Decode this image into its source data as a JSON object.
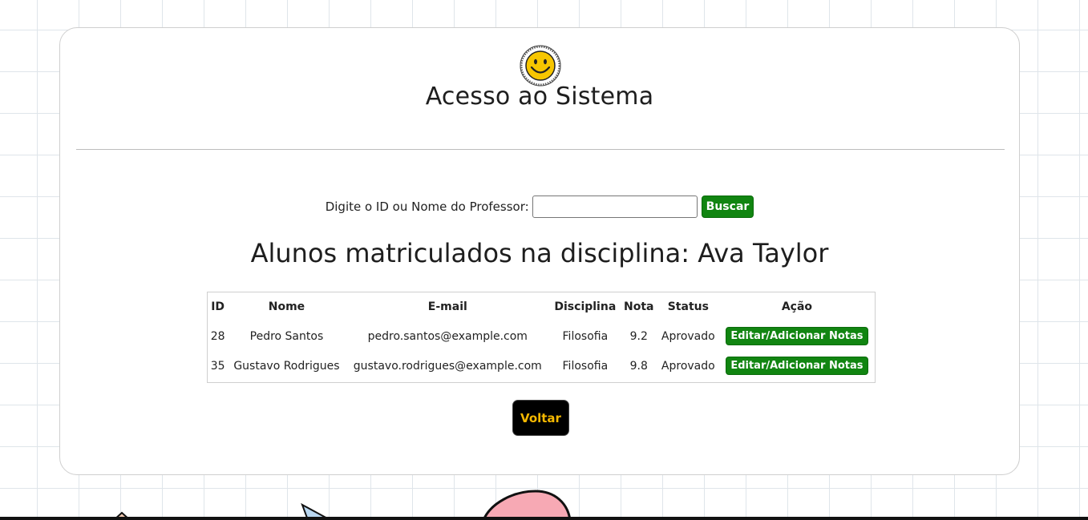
{
  "header": {
    "title": "Acesso ao Sistema"
  },
  "search": {
    "label": "Digite o ID ou Nome do Professor:",
    "value": "",
    "placeholder": "",
    "button_label": "Buscar"
  },
  "main": {
    "subtitle": "Alunos matriculados na disciplina: Ava Taylor"
  },
  "table": {
    "headers": [
      "ID",
      "Nome",
      "E-mail",
      "Disciplina",
      "Nota",
      "Status",
      "Ação"
    ],
    "rows": [
      {
        "id": "28",
        "nome": "Pedro Santos",
        "email": "pedro.santos@example.com",
        "disciplina": "Filosofia",
        "nota": "9.2",
        "status": "Aprovado",
        "acao": "Editar/Adicionar Notas"
      },
      {
        "id": "35",
        "nome": "Gustavo Rodrigues",
        "email": "gustavo.rodrigues@example.com",
        "disciplina": "Filosofia",
        "nota": "9.8",
        "status": "Aprovado",
        "acao": "Editar/Adicionar Notas"
      }
    ]
  },
  "footer": {
    "back_label": "Voltar"
  },
  "colors": {
    "accent_green": "#118511",
    "back_button_bg": "#000000",
    "back_button_text": "#f5b800"
  },
  "icons": {
    "logo": "smiley-face-icon"
  }
}
